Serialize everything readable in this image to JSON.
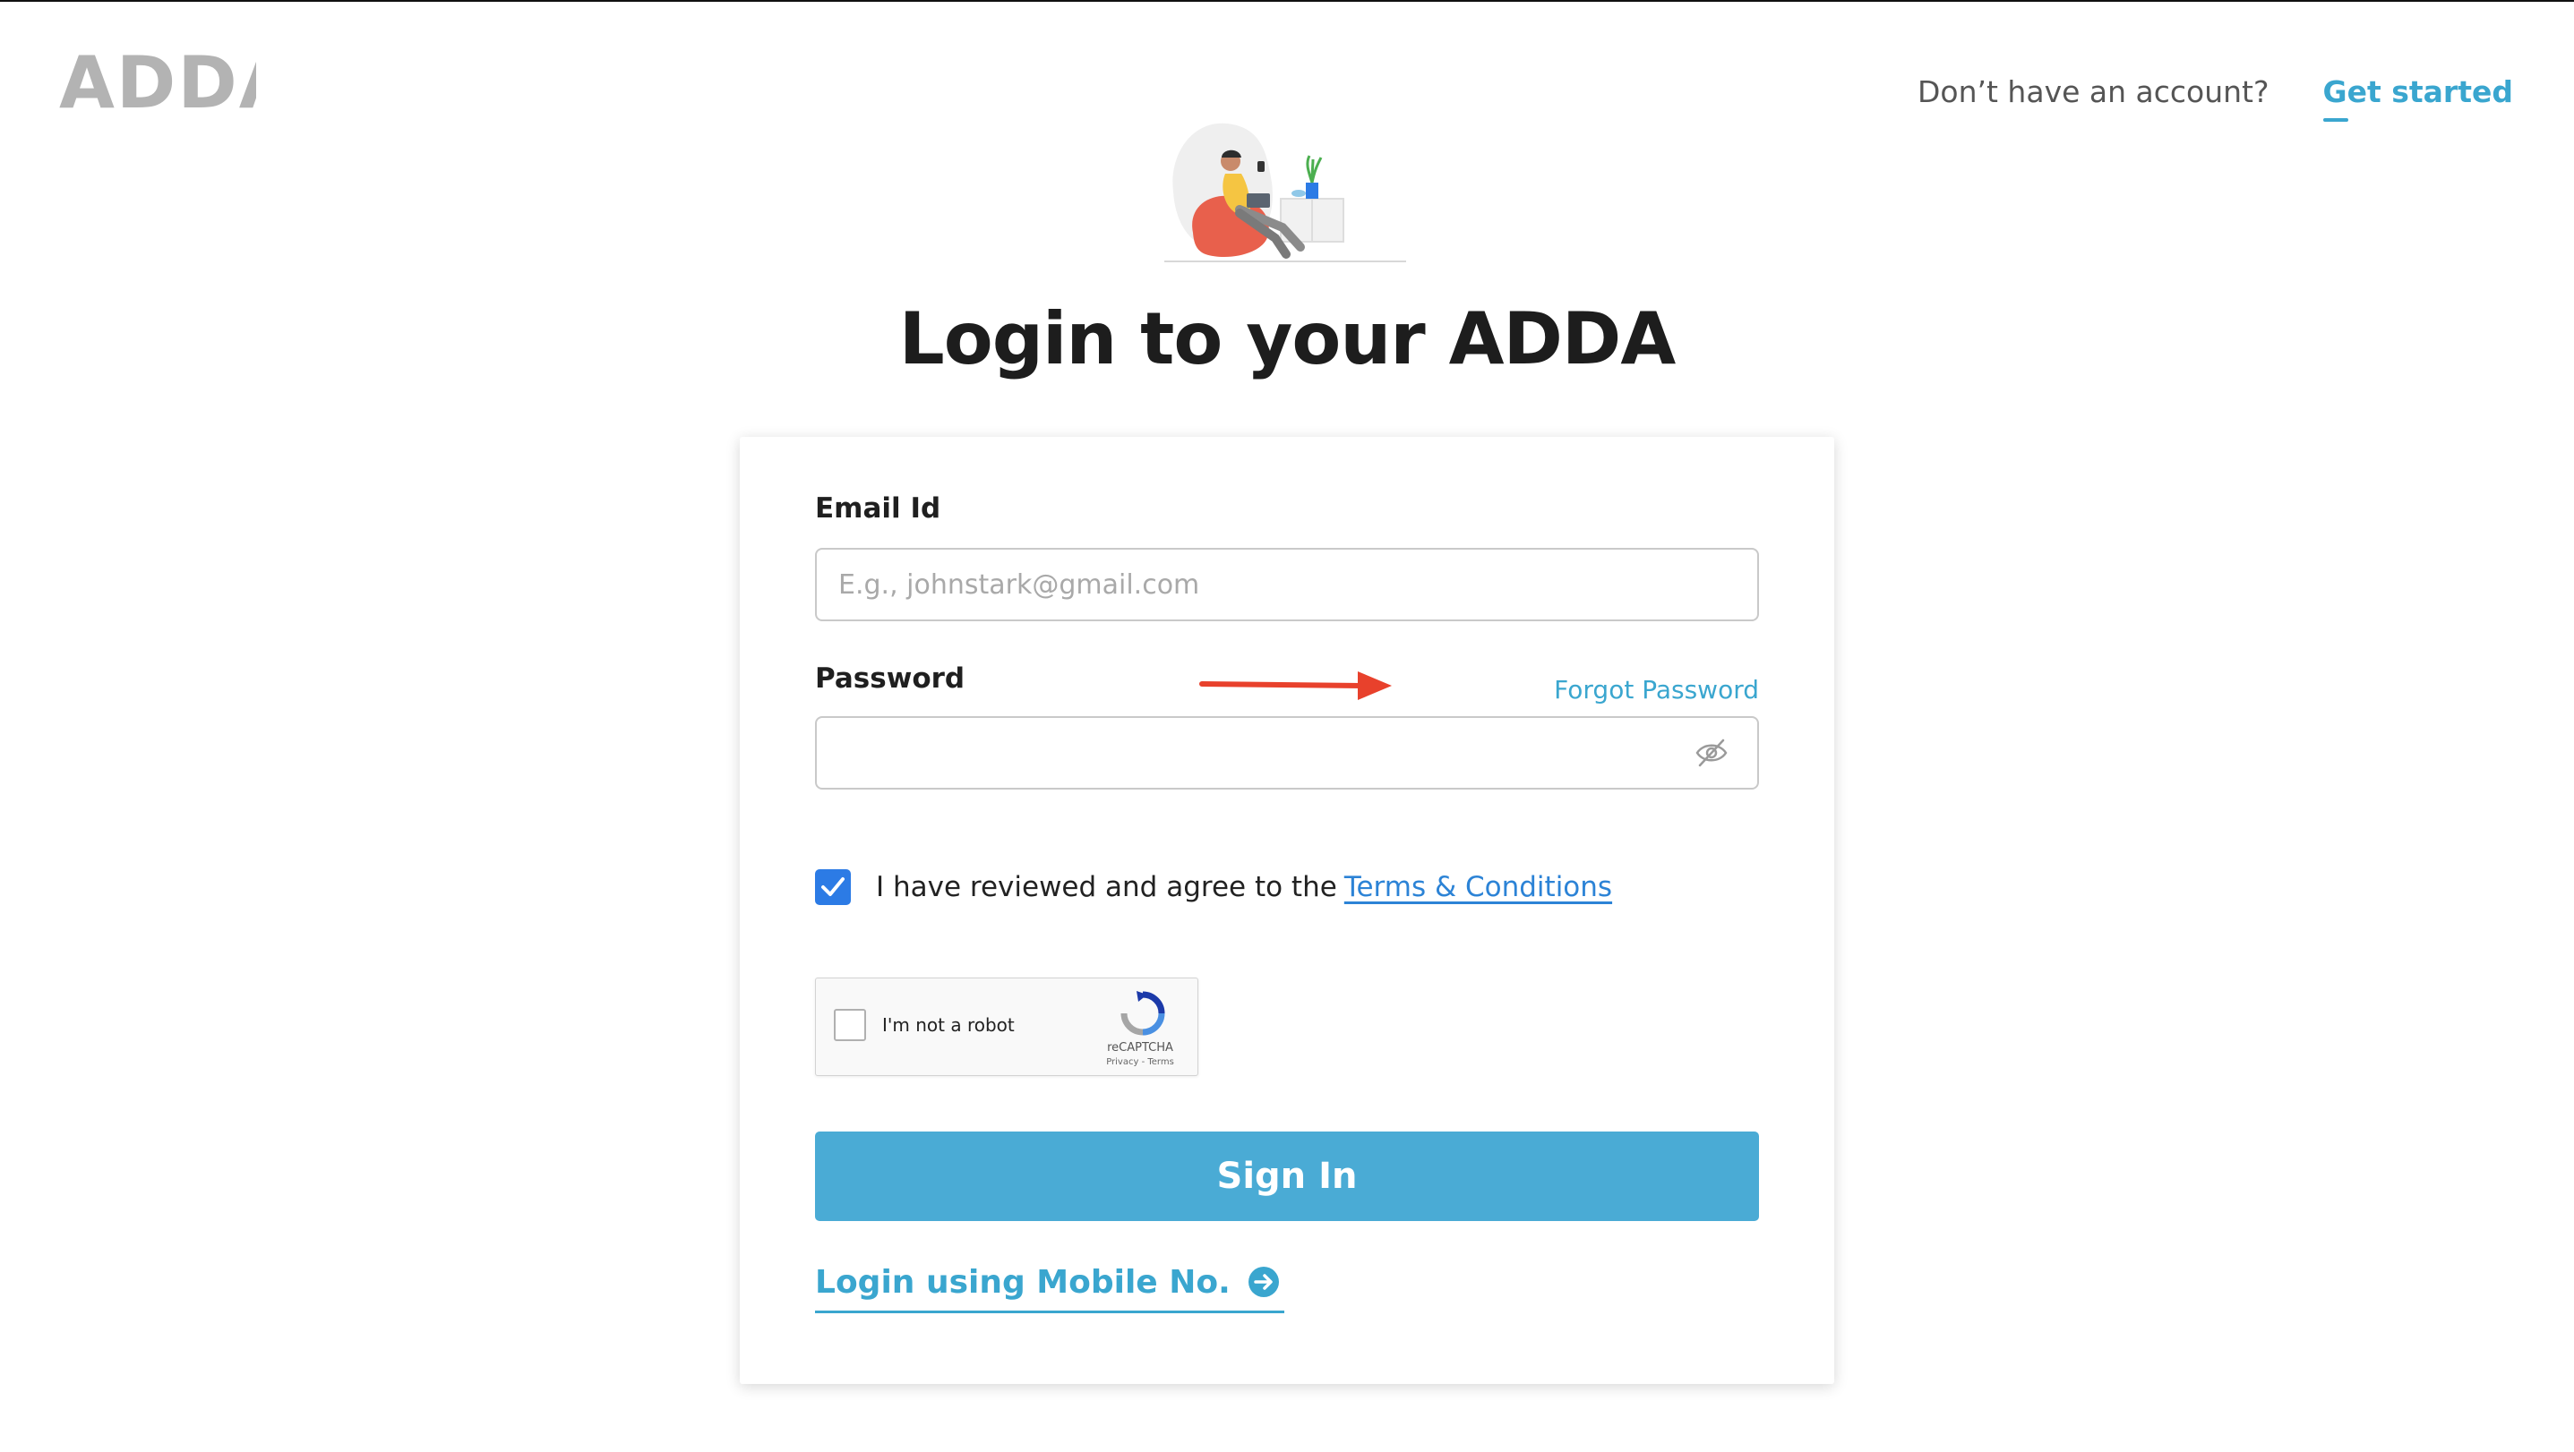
{
  "brand": {
    "logo_text": "ADDA"
  },
  "header": {
    "no_account_text": "Don’t have an account?",
    "get_started_label": "Get started"
  },
  "page": {
    "title": "Login to your ADDA"
  },
  "form": {
    "email_label": "Email Id",
    "email_placeholder": "E.g., johnstark@gmail.com",
    "email_value": "",
    "password_label": "Password",
    "password_value": "",
    "forgot_password_label": "Forgot Password",
    "password_toggle_icon": "eye-slash-icon",
    "agree_checked": true,
    "agree_text": "I have reviewed and agree to the",
    "terms_label": "Terms & Conditions",
    "signin_label": "Sign In",
    "mobile_login_label": "Login using Mobile No.",
    "mobile_login_icon": "arrow-circle-right-icon"
  },
  "recaptcha": {
    "checkbox_label": "I'm not a robot",
    "brand": "reCAPTCHA",
    "links": "Privacy - Terms",
    "checked": false
  },
  "annotation": {
    "icon": "red-arrow-icon",
    "color": "#e8412c"
  },
  "colors": {
    "accent": "#3aa6cf",
    "button": "#4aabd5",
    "checkbox": "#2c7be5",
    "logo": "#b3b3b3",
    "title": "#1d1d1d"
  }
}
